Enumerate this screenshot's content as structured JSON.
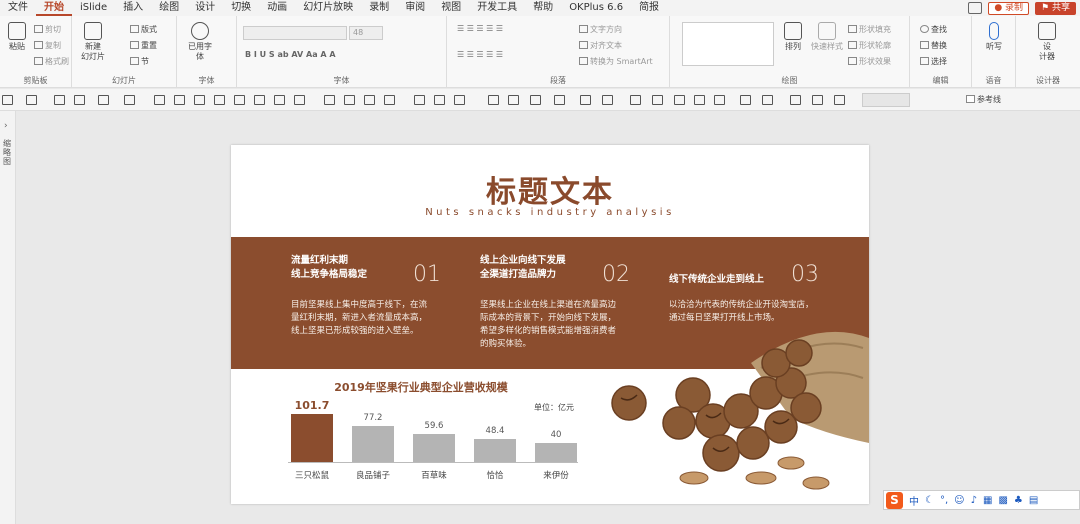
{
  "menubar": {
    "tabs": [
      "文件",
      "开始",
      "iSlide",
      "插入",
      "绘图",
      "设计",
      "切换",
      "动画",
      "幻灯片放映",
      "录制",
      "审阅",
      "视图",
      "开发工具",
      "帮助",
      "OKPlus 6.6",
      "简报"
    ],
    "active_tab": "开始",
    "record_label": "录制",
    "share_label": "共享"
  },
  "ribbon": {
    "clipboard": {
      "paste": "粘贴",
      "cut": "剪切",
      "copy": "复制",
      "format_painter": "格式刷",
      "label": "剪贴板"
    },
    "slides": {
      "new_slide": "新建\n幻灯片",
      "layout": "版式",
      "reset": "重置",
      "section": "节",
      "label": "幻灯片"
    },
    "font_group": {
      "use_font": "已用字\n体",
      "label": "字体"
    },
    "font": {
      "size": "48",
      "label": "字体"
    },
    "paragraph": {
      "text_direction": "文字方向",
      "align_text": "对齐文本",
      "smartart": "转换为 SmartArt",
      "label": "段落"
    },
    "drawing": {
      "arrange": "排列",
      "quick_styles": "快速样式",
      "shape_fill": "形状填充",
      "shape_outline": "形状轮廓",
      "shape_effects": "形状效果",
      "label": "绘图"
    },
    "editing": {
      "find": "查找",
      "replace": "替换",
      "select": "选择",
      "label": "编辑"
    },
    "voice": {
      "dictate": "听写",
      "label": "语音"
    },
    "designer": {
      "design": "设\n计器",
      "label": "设计器"
    }
  },
  "qat": {
    "reference_line": "参考线"
  },
  "left_pane": {
    "label": "缩略图"
  },
  "slide": {
    "title": "标题文本",
    "subtitle": "Nuts snacks industry analysis",
    "columns": [
      {
        "head": "流量红利末期\n线上竞争格局稳定",
        "num": "01",
        "body": "目前坚果线上集中度高于线下，在流\n量红利末期，新进入者流量成本高，\n线上坚果已形成较强的进入壁垒。"
      },
      {
        "head": "线上企业向线下发展\n全渠道打造品牌力",
        "num": "02",
        "body": "坚果线上企业在线上渠道在流量高边\n际成本的背景下，开始向线下发展，\n希望多样化的销售模式能增强消费者\n的购买体验。"
      },
      {
        "head": "线下传统企业走到线上",
        "num": "03",
        "body": "以洽洽为代表的传统企业开设淘宝店，\n通过每日坚果打开线上市场。"
      }
    ],
    "unit": "单位：亿元"
  },
  "chart_data": {
    "type": "bar",
    "title": "2019年坚果行业典型企业营收规模",
    "categories": [
      "三只松鼠",
      "良品铺子",
      "百草味",
      "恰恰",
      "来伊份"
    ],
    "values": [
      101.7,
      77.2,
      59.6,
      48.4,
      40
    ],
    "value_labels": [
      "101.7",
      "77.2",
      "59.6",
      "48.4",
      "40"
    ],
    "highlight_index": 0,
    "colors": {
      "highlight": "#8b4d2e",
      "default": "#b4b4b4"
    },
    "ylim": [
      0,
      101.7
    ]
  },
  "ime": {
    "mode": "中"
  },
  "colors": {
    "accent": "#b7472a",
    "brand": "#8b4d2e"
  }
}
